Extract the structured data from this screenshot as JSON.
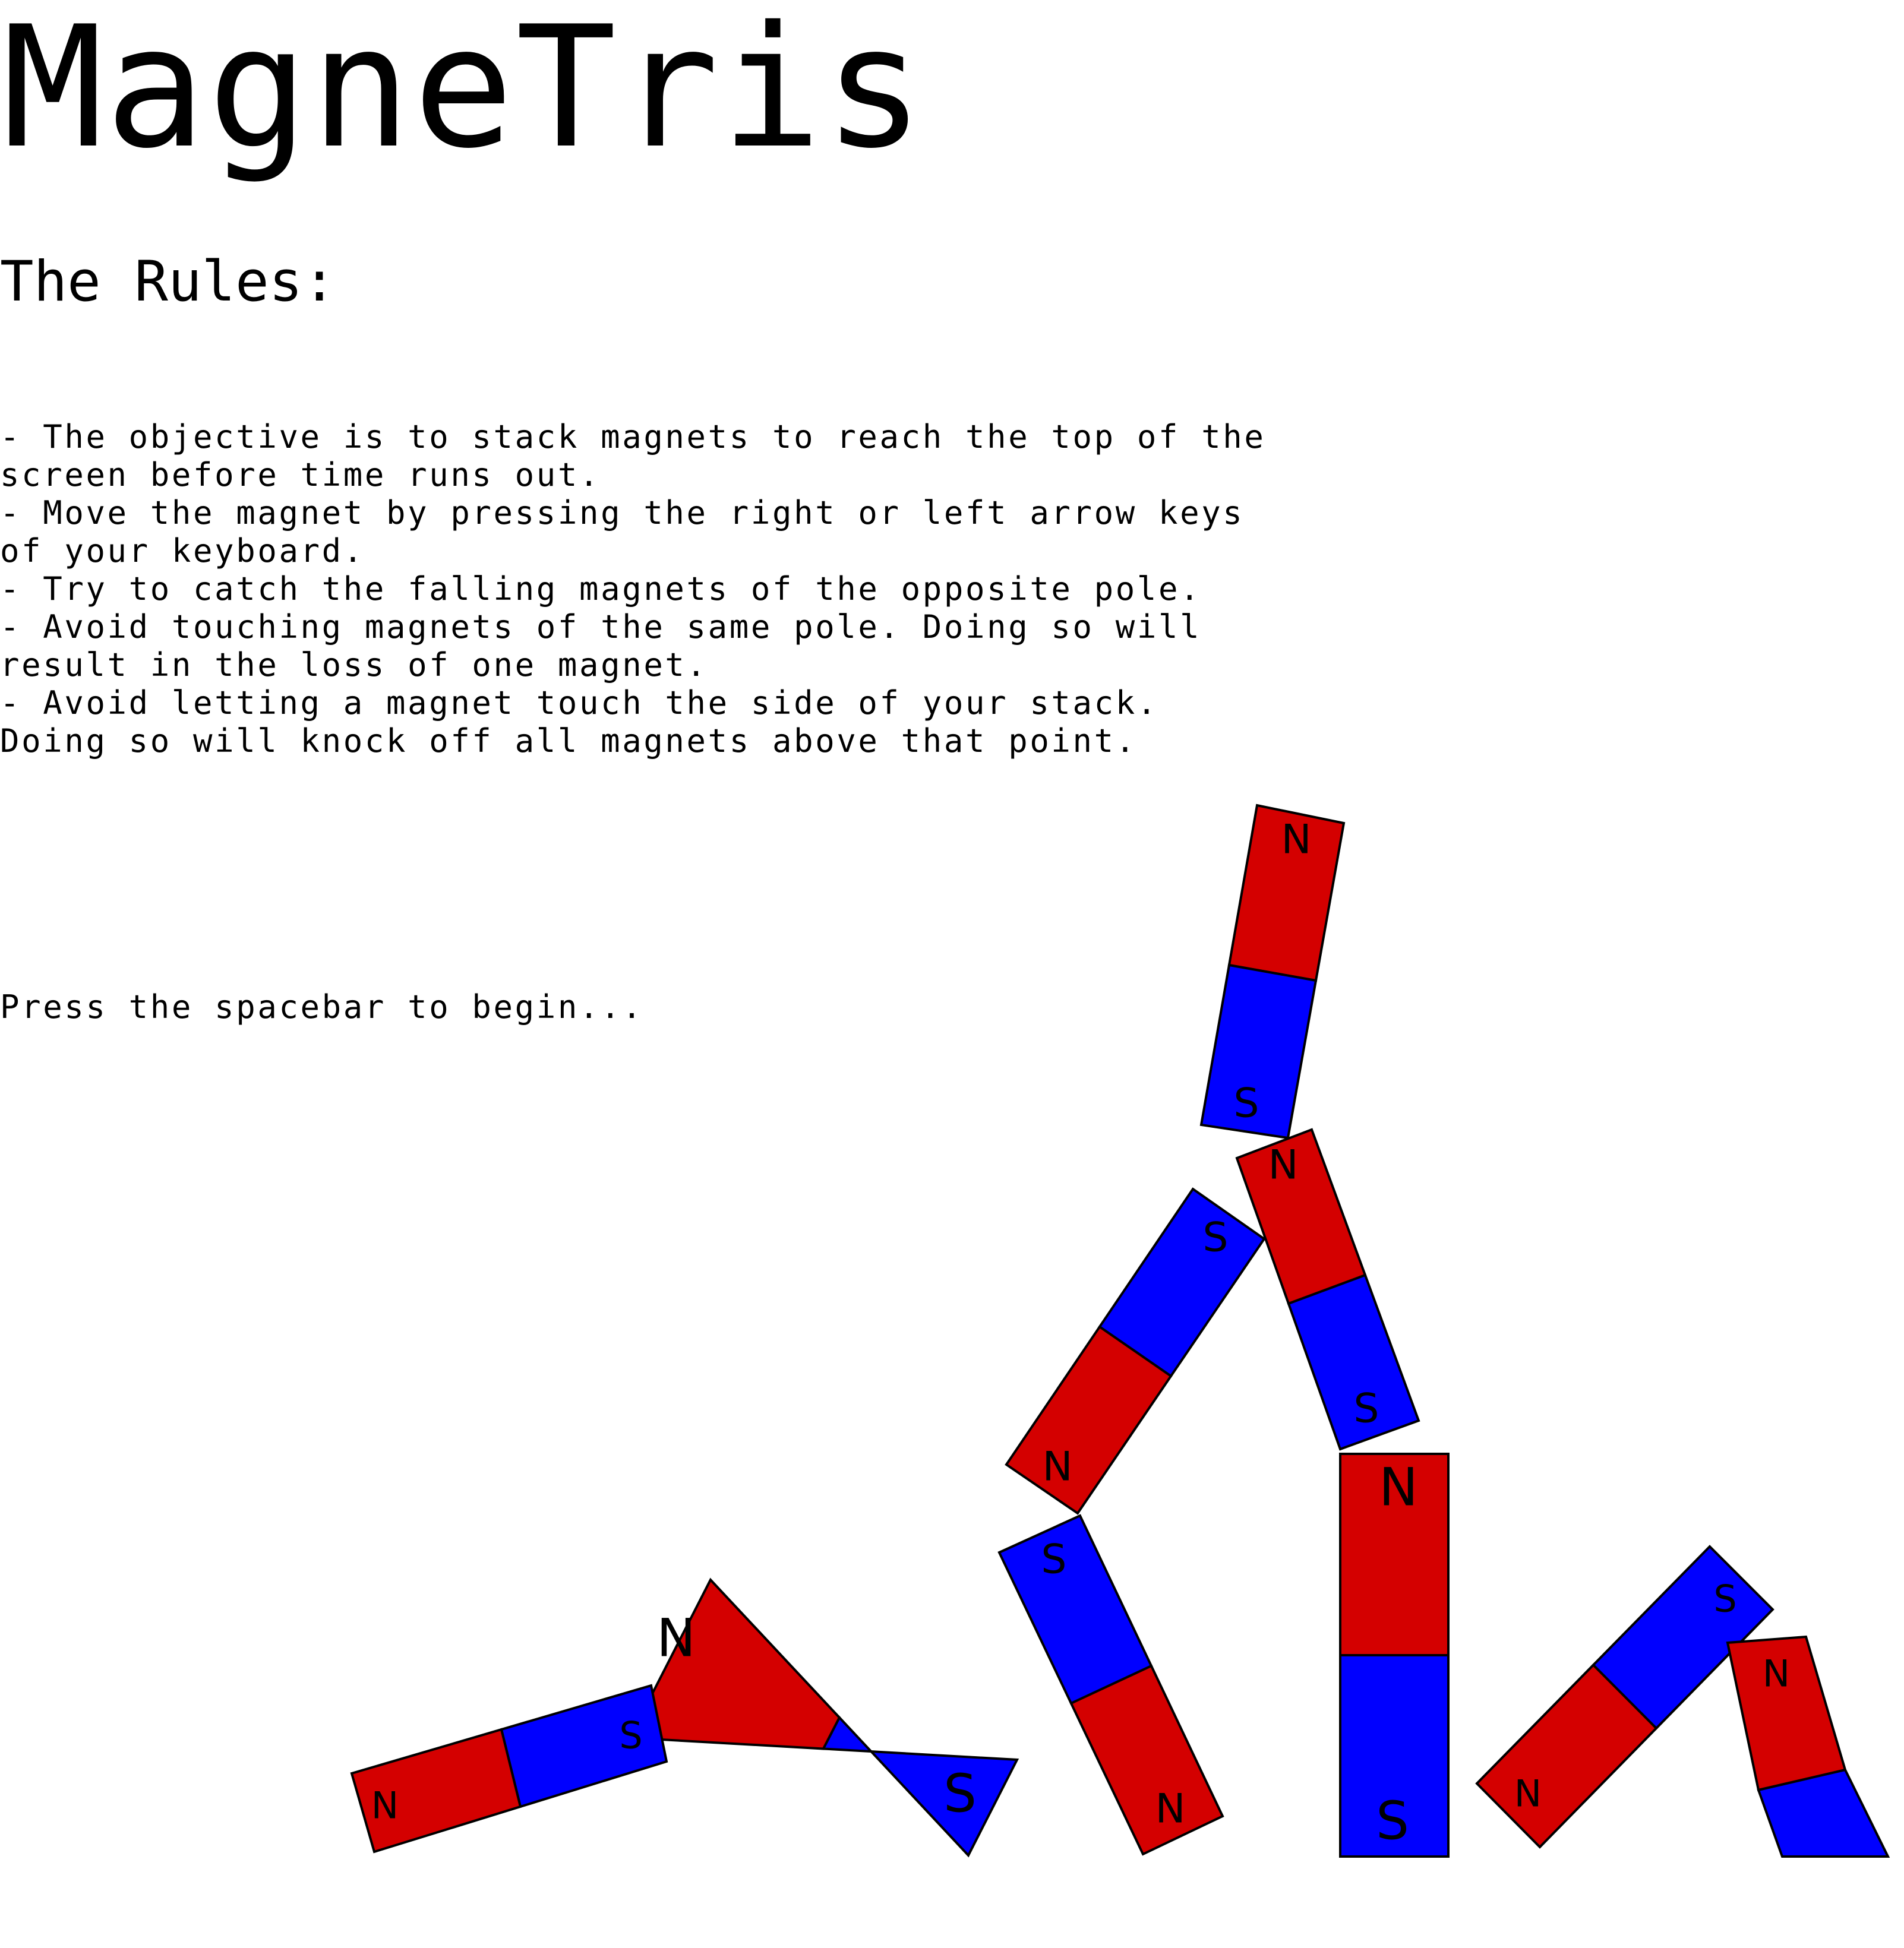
{
  "game": {
    "title": "MagneTris"
  },
  "rules": {
    "heading": "The Rules:",
    "lines": [
      "- The objective is to stack magnets to reach the top of the",
      "screen before time runs out.",
      "- Move the magnet by pressing the right or left arrow keys",
      "of your keyboard.",
      "- Try to catch the falling magnets of the opposite pole.",
      "- Avoid touching magnets of the same pole. Doing so will",
      "result in the loss of one magnet.",
      "- Avoid letting a magnet touch the side of your stack.",
      "Doing so will knock off all magnets above that point."
    ]
  },
  "prompt": {
    "start": "Press the spacebar to begin..."
  },
  "magnets": {
    "north_label": "N",
    "south_label": "S",
    "colors": {
      "north": "#d40000",
      "south": "#0000ff",
      "outline": "#000000"
    }
  }
}
